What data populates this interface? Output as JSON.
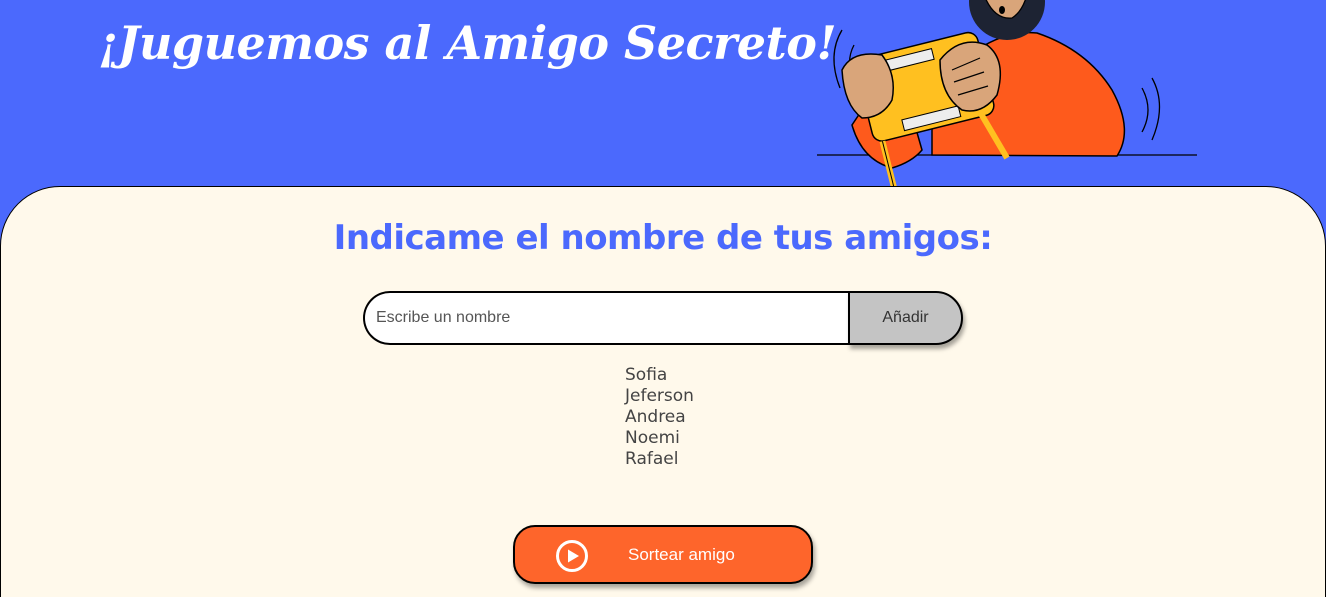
{
  "header": {
    "title": "¡Juguemos al Amigo Secreto!",
    "illustration_icon": "person-playing-game-console-illustration"
  },
  "main": {
    "subtitle": "Indicame el nombre de tus amigos:",
    "input": {
      "placeholder": "Escribe un nombre",
      "value": ""
    },
    "add_button_label": "Añadir",
    "friends": [
      "Sofia",
      "Jeferson",
      "Andrea",
      "Noemi",
      "Rafael"
    ],
    "draw_button": {
      "label": "Sortear amigo",
      "icon": "play-circle-icon"
    }
  },
  "colors": {
    "background_blue": "#4B69FD",
    "panel_cream": "#FFF9EB",
    "accent_orange": "#FE652B",
    "button_gray": "#C4C4C4"
  }
}
